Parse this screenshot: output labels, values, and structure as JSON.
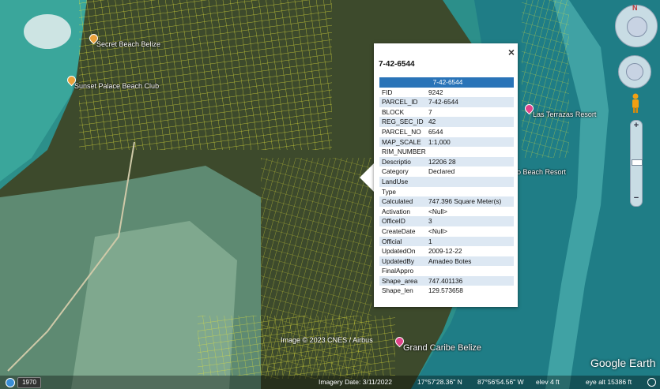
{
  "map": {
    "placemarks": [
      {
        "label": "Secret Beach Belize",
        "color": "orange"
      },
      {
        "label": "Sunset Palace Beach Club",
        "color": "orange"
      },
      {
        "label": "Las Terrazas Resort",
        "color": "pink"
      },
      {
        "label": "o Beach Resort",
        "color": "none"
      },
      {
        "label": "Grand Caribe Belize",
        "color": "pink"
      }
    ],
    "copyright": "Image © 2023 CNES / Airbus",
    "logo": "Google Earth",
    "colors": {
      "parcel": "#e6e63a",
      "sea": "#2c8f8a",
      "land": "#3d4a2c",
      "lagoon": "#7a9e8a"
    }
  },
  "balloon": {
    "title": "7-42-6544",
    "header": "7-42-6544",
    "close": "×",
    "rows": [
      {
        "k": "FID",
        "v": "9242"
      },
      {
        "k": "PARCEL_ID",
        "v": "7-42-6544"
      },
      {
        "k": "BLOCK",
        "v": "7"
      },
      {
        "k": "REG_SEC_ID",
        "v": "42"
      },
      {
        "k": "PARCEL_NO",
        "v": "6544"
      },
      {
        "k": "MAP_SCALE",
        "v": "1:1,000"
      },
      {
        "k": "RIM_NUMBER",
        "v": ""
      },
      {
        "k": "Descriptio",
        "v": "12206 28"
      },
      {
        "k": "Category",
        "v": "Declared"
      },
      {
        "k": "LandUse",
        "v": ""
      },
      {
        "k": "Type",
        "v": ""
      },
      {
        "k": "Calculated",
        "v": "747.396 Square Meter(s)"
      },
      {
        "k": "Activation",
        "v": "<Null>"
      },
      {
        "k": "OfficeID",
        "v": "3"
      },
      {
        "k": "CreateDate",
        "v": "<Null>"
      },
      {
        "k": "Official",
        "v": "1"
      },
      {
        "k": "UpdatedOn",
        "v": "2009-12-22"
      },
      {
        "k": "UpdatedBy",
        "v": "Amadeo Botes"
      },
      {
        "k": "FinalAppro",
        "v": ""
      },
      {
        "k": "Shape_area",
        "v": "747.401136"
      },
      {
        "k": "Shape_len",
        "v": "129.573658"
      }
    ]
  },
  "controls": {
    "north": "N",
    "zoom_in": "+",
    "zoom_out": "−"
  },
  "status": {
    "year": "1970",
    "imagery_date": "Imagery Date: 3/11/2022",
    "lat": "17°57'28.36\" N",
    "lon": "87°56'54.56\" W",
    "elev": "elev    4 ft",
    "eye_alt": "eye alt  15386 ft"
  }
}
